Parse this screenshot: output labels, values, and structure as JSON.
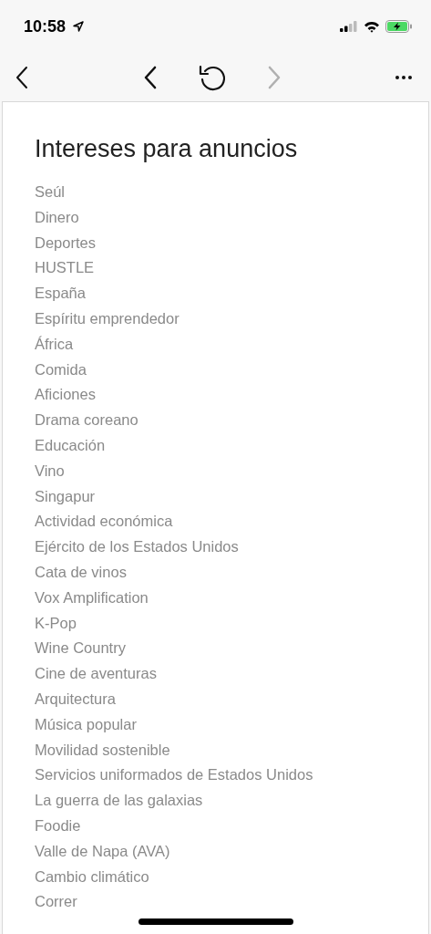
{
  "status_bar": {
    "time": "10:58"
  },
  "nav": {
    "buttons": [
      {
        "kind": "back",
        "disabled": false
      },
      {
        "kind": "history-back",
        "disabled": false
      },
      {
        "kind": "reload",
        "disabled": false
      },
      {
        "kind": "forward",
        "disabled": true
      },
      {
        "kind": "more",
        "disabled": false
      }
    ]
  },
  "title": "Intereses para anuncios",
  "items": [
    "Seúl",
    "Dinero",
    "Deportes",
    "HUSTLE",
    "España",
    "Espíritu emprendedor",
    "África",
    "Comida",
    "Aficiones",
    "Drama coreano",
    "Educación",
    "Vino",
    "Singapur",
    "Actividad económica",
    "Ejército de los Estados Unidos",
    "Cata de vinos",
    "Vox Amplification",
    "K-Pop",
    "Wine Country",
    "Cine de aventuras",
    "Arquitectura",
    "Música popular",
    "Movilidad sostenible",
    "Servicios uniformados de Estados Unidos",
    "La guerra de las galaxias",
    "Foodie",
    "Valle de Napa (AVA)",
    "Cambio climático",
    "Correr"
  ]
}
